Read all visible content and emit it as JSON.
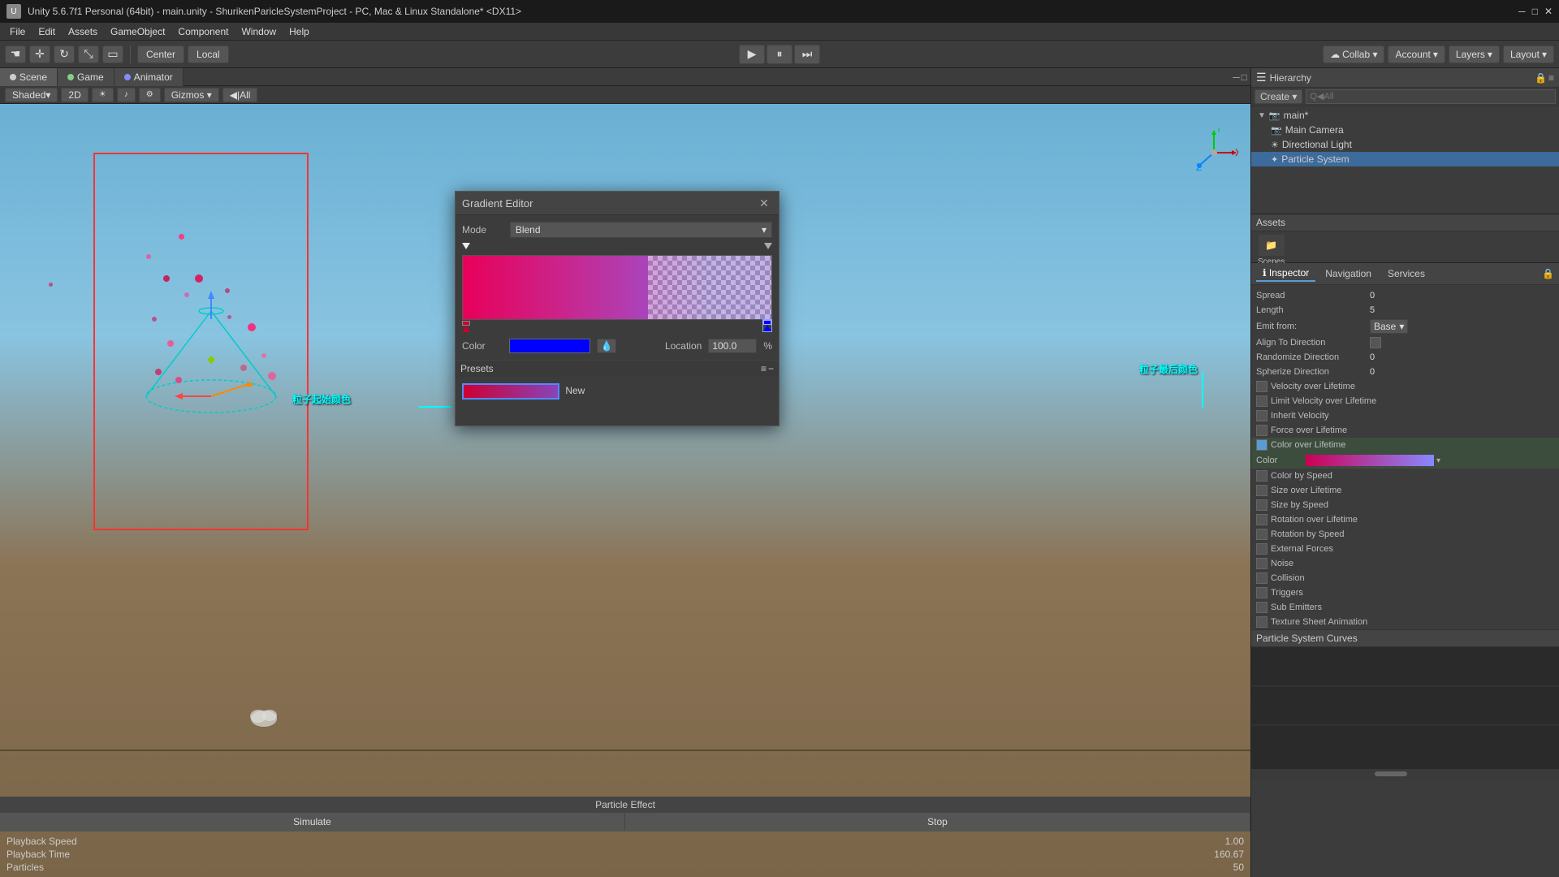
{
  "window": {
    "title": "Unity 5.6.7f1 Personal (64bit) - main.unity - ShurikenParicleSystemProject - PC, Mac & Linux Standalone* <DX11>"
  },
  "menu": {
    "items": [
      "File",
      "Edit",
      "Assets",
      "GameObject",
      "Component",
      "Window",
      "Help"
    ]
  },
  "toolbar": {
    "center_label": "Center",
    "local_label": "Local",
    "collab_label": "Collab ▾",
    "account_label": "Account",
    "layers_label": "Layers",
    "layout_label": "Layout"
  },
  "tabs": {
    "scene": "Scene",
    "game": "Game",
    "animator": "Animator"
  },
  "scene_toolbar": {
    "shaded": "Shaded",
    "2d": "2D",
    "gizmos": "Gizmos ▾",
    "all": "◀|All"
  },
  "hierarchy": {
    "panel_title": "Hierarchy",
    "create_label": "Create ▾",
    "search_placeholder": "Q◀All",
    "items": [
      {
        "name": "main*",
        "level": 0,
        "icon": "▶"
      },
      {
        "name": "Main Camera",
        "level": 1
      },
      {
        "name": "Directional Light",
        "level": 1
      },
      {
        "name": "Particle System",
        "level": 1
      }
    ]
  },
  "inspector": {
    "panel_title": "Inspector",
    "nav_title": "Navigation",
    "services_title": "Services",
    "rows": [
      {
        "label": "Spread",
        "value": "0"
      },
      {
        "label": "Length",
        "value": "5"
      },
      {
        "label": "Emit from:",
        "value": "Base",
        "type": "dropdown"
      },
      {
        "label": "Align To Direction",
        "value": "",
        "type": "checkbox"
      },
      {
        "label": "Randomize Direction",
        "value": "0"
      },
      {
        "label": "Spherize Direction",
        "value": "0"
      }
    ],
    "sections": [
      {
        "label": "Velocity over Lifetime",
        "checked": false
      },
      {
        "label": "Limit Velocity over Lifetime",
        "checked": false
      },
      {
        "label": "Inherit Velocity",
        "checked": false
      },
      {
        "label": "Force over Lifetime",
        "checked": false
      },
      {
        "label": "Color over Lifetime",
        "checked": true
      },
      {
        "label": "Color by Speed",
        "checked": false
      },
      {
        "label": "Size over Lifetime",
        "checked": false
      },
      {
        "label": "Size by Speed",
        "checked": false
      },
      {
        "label": "Rotation over Lifetime",
        "checked": false
      },
      {
        "label": "Rotation by Speed",
        "checked": false
      },
      {
        "label": "External Forces",
        "checked": false
      },
      {
        "label": "Noise",
        "checked": false
      },
      {
        "label": "Collision",
        "checked": false
      },
      {
        "label": "Triggers",
        "checked": false
      },
      {
        "label": "Sub Emitters",
        "checked": false
      },
      {
        "label": "Texture Sheet Animation",
        "checked": false
      }
    ],
    "color_label": "Color",
    "curves_title": "Particle System Curves"
  },
  "gradient_editor": {
    "title": "Gradient Editor",
    "mode_label": "Mode",
    "mode_value": "Blend",
    "color_label": "Color",
    "location_label": "Location",
    "location_value": "100.0",
    "location_unit": "%",
    "presets_label": "Presets",
    "new_label": "New"
  },
  "assets": {
    "panel_title": "Assets",
    "scenes_label": "Scenes"
  },
  "particle_effect": {
    "title": "Particle Effect",
    "simulate_label": "Simulate",
    "stop_label": "Stop",
    "stats": [
      {
        "label": "Playback Speed",
        "value": "1.00"
      },
      {
        "label": "Playback Time",
        "value": "160.67"
      },
      {
        "label": "Particles",
        "value": "50"
      }
    ]
  },
  "labels": {
    "start_color_cn": "粒子起始颜色",
    "end_color_cn": "粒子最后颜色"
  },
  "colors": {
    "accent_blue": "#3d6b9c",
    "panel_bg": "#3c3c3c",
    "border": "#222222",
    "gradient_start": "#e8005a",
    "gradient_end": "#8888ff"
  }
}
